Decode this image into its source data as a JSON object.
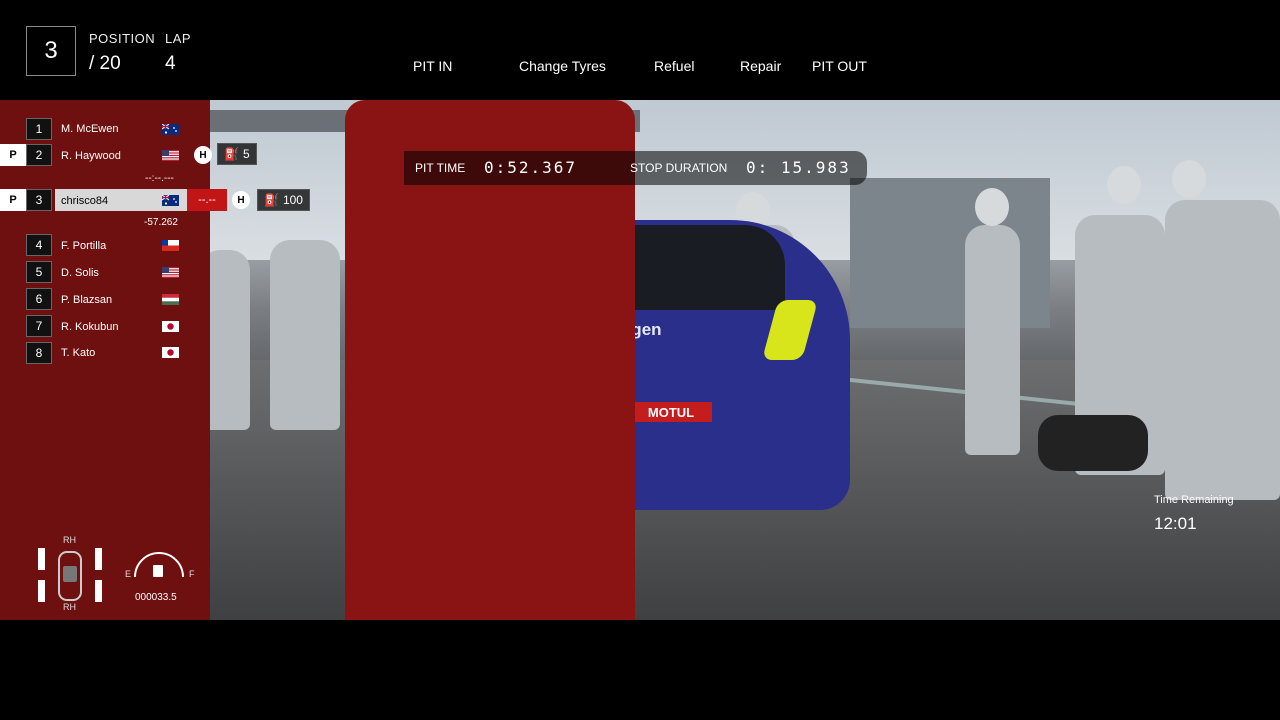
{
  "hud": {
    "position_value": "3",
    "position_label": "POSITION",
    "position_total": "/ 20",
    "lap_label": "LAP",
    "lap_value": "4"
  },
  "pit_menu": {
    "pit_in": "PIT IN",
    "change_tyres": "Change Tyres",
    "refuel": "Refuel",
    "repair": "Repair",
    "pit_out": "PIT OUT"
  },
  "pit_timer": {
    "pit_time_label": "PIT TIME",
    "pit_time_value": "0:52.367",
    "stop_duration_label": "STOP DURATION",
    "stop_duration_value": "0: 15.983"
  },
  "leaderboard": [
    {
      "pos": "1",
      "name": "M. McEwen",
      "flag": "australia"
    },
    {
      "pos": "2",
      "name": "R. Haywood",
      "flag": "usa",
      "pit": "P",
      "tyre": "H",
      "fuel": "5",
      "gap": "--:--.---"
    },
    {
      "pos": "3",
      "name": "chrisco84",
      "flag": "australia",
      "pit": "P",
      "tyre": "H",
      "fuel": "100",
      "delta": "--.--",
      "gap": "-57.262"
    },
    {
      "pos": "4",
      "name": "F. Portilla",
      "flag": "chile"
    },
    {
      "pos": "5",
      "name": "D. Solis",
      "flag": "usa"
    },
    {
      "pos": "6",
      "name": "P. Blazsan",
      "flag": "hungary"
    },
    {
      "pos": "7",
      "name": "R. Kokubun",
      "flag": "japan"
    },
    {
      "pos": "8",
      "name": "T. Kato",
      "flag": "japan"
    }
  ],
  "car_status": {
    "tyre_front_label": "RH",
    "tyre_rear_label": "RH",
    "fuel_empty": "E",
    "fuel_full": "F",
    "odometer": "000033.5"
  },
  "time_remaining": {
    "label": "Time Remaining",
    "value": "12:01"
  },
  "colors": {
    "player_row": "#d8d8d8",
    "delta_red": "#c21515",
    "pit_badge": "#ffffff"
  }
}
